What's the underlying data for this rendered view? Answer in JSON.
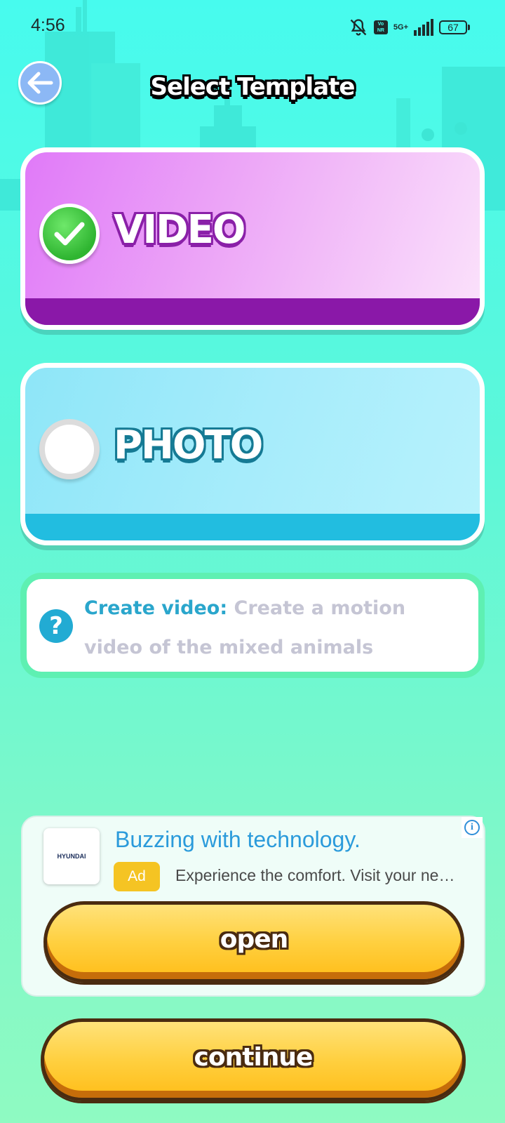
{
  "status_bar": {
    "time": "4:56",
    "volte": "Vo NR",
    "network": "5G+",
    "battery": "67"
  },
  "header": {
    "title": "Select Template",
    "back_icon": "arrow-left-icon"
  },
  "options": [
    {
      "label": "VIDEO",
      "selected": true,
      "color": "#e07af8"
    },
    {
      "label": "PHOTO",
      "selected": false,
      "color": "#8ee6f8"
    }
  ],
  "info": {
    "lead": "Create video:",
    "description": "Create a motion video of the mixed animals"
  },
  "ad": {
    "advertiser_logo": "HYUNDAI",
    "headline": "Buzzing with technology.",
    "badge": "Ad",
    "body": "Experience the comfort. Visit your nearest dealership",
    "cta": "open"
  },
  "footer": {
    "continue_label": "continue"
  },
  "colors": {
    "accent_yellow": "#ffd040",
    "button_outline": "#4a2b10",
    "info_accent": "#2aa6cc"
  }
}
